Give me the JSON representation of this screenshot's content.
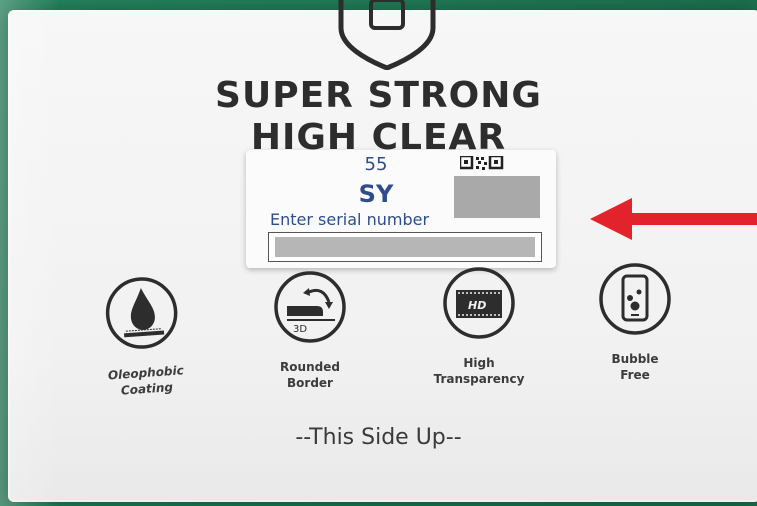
{
  "packaging": {
    "headline_line1": "SUPER STRONG",
    "headline_line2": "HIGH CLEAR"
  },
  "label": {
    "number": "55",
    "code": "SY",
    "hint": "Enter serial number"
  },
  "features": [
    {
      "icon": "oil-drop-icon",
      "line1": "Oleophobic",
      "line2": "Coating"
    },
    {
      "icon": "rounded-border-3d-icon",
      "line1": "Rounded",
      "line2": "Border"
    },
    {
      "icon": "hd-film-icon",
      "line1": "High",
      "line2": "Transparency"
    },
    {
      "icon": "bubble-phone-icon",
      "line1": "Bubble",
      "line2": "Free"
    }
  ],
  "side_text": "--This Side Up--",
  "colors": {
    "background_mat": "#1f7a56",
    "label_text": "#2f4d8a",
    "arrow": "#e2232b",
    "print_dark": "#2d2d2d"
  }
}
